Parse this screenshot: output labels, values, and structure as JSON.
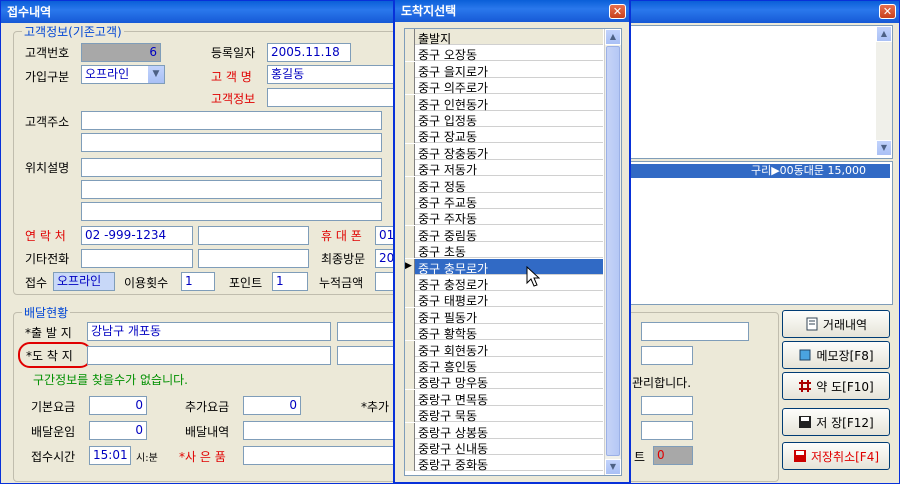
{
  "main": {
    "title": "접수내역",
    "customer_group": {
      "legend": "고객정보(기존고객)",
      "customer_no_label": "고객번호",
      "customer_no": "6",
      "reg_date_label": "등록일자",
      "reg_date": "2005.11.18",
      "join_type_label": "가입구분",
      "join_type": "오프라인",
      "name_label": "고 객 명",
      "name": "홍길동",
      "info_label": "고객정보",
      "address_label": "고객주소",
      "location_label": "위치설명",
      "contact_label": "연 락 처",
      "contact": "02  -999-1234",
      "mobile_label": "휴 대 폰",
      "mobile": "01",
      "other_phone_label": "기타전화",
      "last_visit_label": "최종방문",
      "last_visit": "200",
      "receipt_label": "접수",
      "receipt": "오프라인",
      "use_count_label": "이용횟수",
      "use_count": "1",
      "point_label": "포인트",
      "point": "1",
      "total_amount_label": "누적금액"
    },
    "delivery_group": {
      "legend": "배달현황",
      "origin_label": "*출 발 지",
      "origin": "강남구 개포동",
      "destination_label": "*도 착 지",
      "section_msg": "구간정보를 찾을수가 없습니다.",
      "manage_msg": "관리합니다.",
      "base_fee_label": "기본요금",
      "base_fee": "0",
      "extra_fee_label": "추가요금",
      "extra_fee": "0",
      "extra2_label": "*추가",
      "delivery_fee_label": "배달운임",
      "delivery_fee": "0",
      "delivery_detail_label": "배달내역",
      "receipt_time_label": "접수시간",
      "receipt_time": "15:01",
      "time_unit": "시:분",
      "goods_label": "*사 은 품",
      "point_tail_label": "트",
      "point_tail_value": "0"
    },
    "history_row": "구리▶00동대문  15,000",
    "buttons": {
      "trade": "거래내역",
      "memo": "메모장[F8]",
      "map": "약 도[F10]",
      "save": "저 장[F12]",
      "cancel": "저장취소[F4]"
    }
  },
  "popup": {
    "title": "도착지선택",
    "header": "출발지",
    "items": [
      "중구 오장동",
      "중구 을지로가",
      "중구 의주로가",
      "중구 인현동가",
      "중구 입정동",
      "중구 장교동",
      "중구 장충동가",
      "중구 저동가",
      "중구 정동",
      "중구 주교동",
      "중구 주자동",
      "중구 중림동",
      "중구 초동",
      "중구 충무로가",
      "중구 충정로가",
      "중구 태평로가",
      "중구 필동가",
      "중구 황학동",
      "중구 회현동가",
      "중구 흥인동",
      "중랑구 망우동",
      "중랑구 면목동",
      "중랑구 묵동",
      "중랑구 상봉동",
      "중랑구 신내동",
      "중랑구 중화동"
    ],
    "selected_index": 13
  }
}
